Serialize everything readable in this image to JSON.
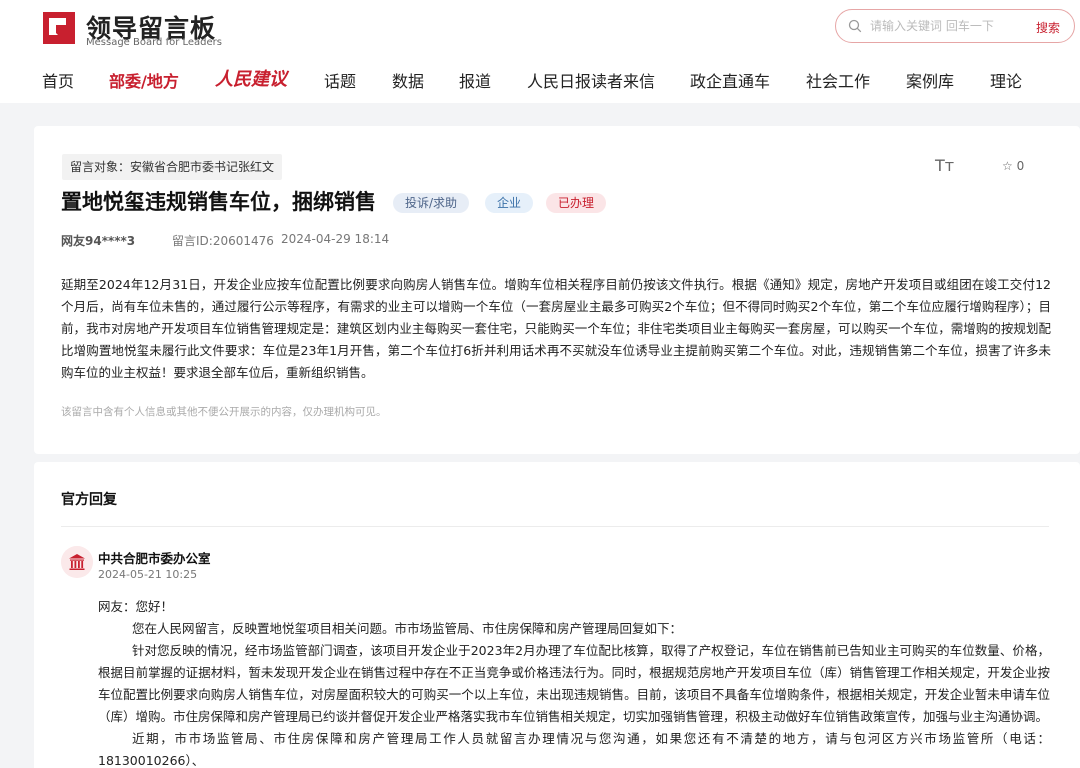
{
  "header": {
    "logo_cn": "领导留言板",
    "logo_en": "Message Board for Leaders",
    "search_placeholder": "请输入关键词 回车一下",
    "search_button": "搜索"
  },
  "nav": {
    "items": [
      "首页",
      "部委/地方",
      "人民建议",
      "话题",
      "数据",
      "报道",
      "人民日报读者来信",
      "政企直通车",
      "社会工作",
      "案例库",
      "理论"
    ],
    "active_index": 1
  },
  "message": {
    "target": "留言对象：安徽省合肥市委书记张红文",
    "title": "置地悦玺违规销售车位，捆绑销售",
    "tags": [
      "投诉/求助",
      "企业",
      "已办理"
    ],
    "user": "网友94****3",
    "id_label": "留言ID:20601476",
    "time": "2024-04-29 18:14",
    "favorite_count": "0",
    "text_size_icon": "Tт",
    "body": "延期至2024年12月31日，开发企业应按车位配置比例要求向购房人销售车位。增购车位相关程序目前仍按该文件执行。根据《通知》规定，房地产开发项目或组团在竣工交付12个月后，尚有车位未售的，通过履行公示等程序，有需求的业主可以增购一个车位（一套房屋业主最多可购买2个车位；但不得同时购买2个车位，第二个车位应履行增购程序）；目前，我市对房地产开发项目车位销售管理规定是：建筑区划内业主每购买一套住宅，只能购买一个车位；非住宅类项目业主每购买一套房屋，可以购买一个车位，需增购的按规划配比增购置地悦玺未履行此文件要求：车位是23年1月开售，第二个车位打6折并利用话术再不买就没车位诱导业主提前购买第二个车位。对此，违规销售第二个车位，损害了许多未购车位的业主权益！要求退全部车位后，重新组织销售。",
    "privacy_note": "该留言中含有个人信息或其他不便公开展示的内容，仅办理机构可见。"
  },
  "reply": {
    "heading": "官方回复",
    "org": "中共合肥市委办公室",
    "time": "2024-05-21 10:25",
    "greeting": "网友：您好！",
    "p1": "您在人民网留言，反映置地悦玺项目相关问题。市市场监管局、市住房保障和房产管理局回复如下：",
    "p2": "针对您反映的情况，经市场监管部门调查，该项目开发企业于2023年2月办理了车位配比核算，取得了产权登记，车位在销售前已告知业主可购买的车位数量、价格，根据目前掌握的证据材料，暂未发现开发企业在销售过程中存在不正当竞争或价格违法行为。同时，根据规范房地产开发项目车位（库）销售管理工作相关规定，开发企业按车位配置比例要求向购房人销售车位，对房屋面积较大的可购买一个以上车位，未出现违规销售。目前，该项目不具备车位增购条件，根据相关规定，开发企业暂未申请车位（库）增购。市住房保障和房产管理局已约谈并督促开发企业严格落实我市车位销售相关规定，切实加强销售管理，积极主动做好车位销售政策宣传，加强与业主沟通协调。",
    "p3": "近期，市市场监管局、市住房保障和房产管理局工作人员就留言办理情况与您沟通，如果您还有不清楚的地方，请与包河区方兴市场监管所（电话：18130010266）、"
  },
  "colors": {
    "brand_red": "#c8202f",
    "page_bg": "#f3f4f6"
  }
}
